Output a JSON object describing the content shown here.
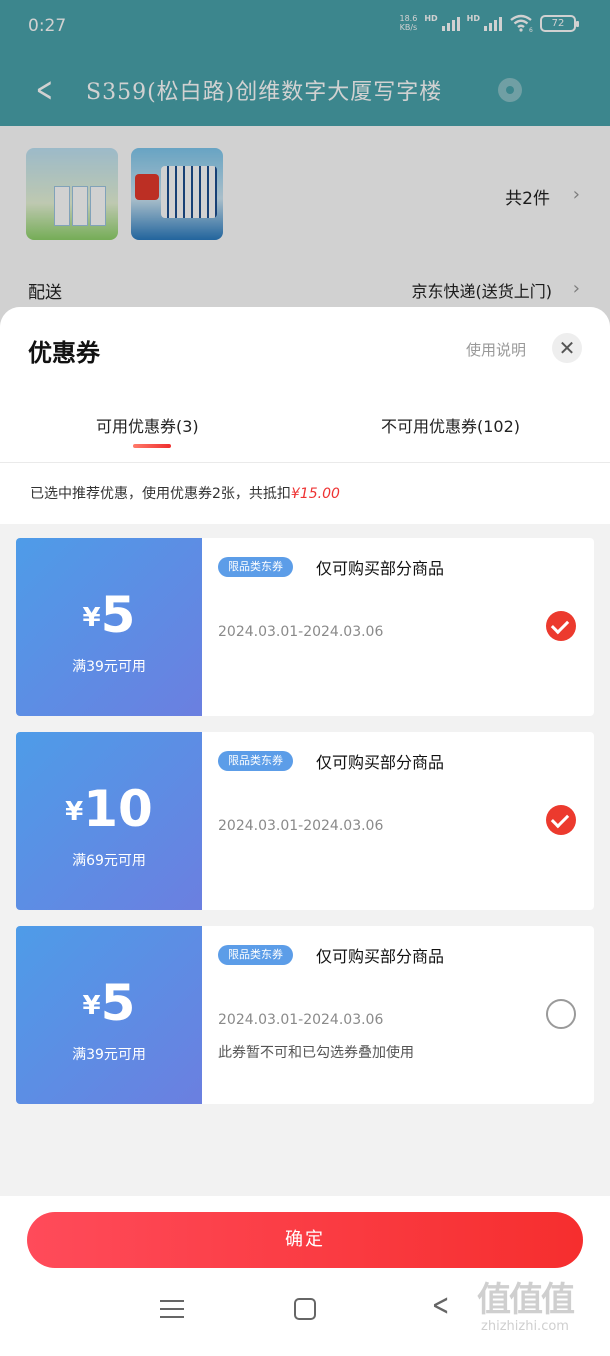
{
  "status_bar": {
    "time": "0:27",
    "net_speed": "18.6",
    "net_unit": "KB/s",
    "hd1": "HD",
    "hd2": "HD",
    "wifi_sub": "6",
    "battery": "72"
  },
  "nav": {
    "title": "S359(松白路)创维数字大厦写字楼",
    "back_icon": "chevron-left-icon",
    "location_icon": "location-pin-icon"
  },
  "order": {
    "item_count": "共2件",
    "delivery_label": "配送",
    "delivery_value": "京东快递(送货上门)"
  },
  "sheet": {
    "title": "优惠券",
    "usage_link": "使用说明",
    "close_icon": "close-icon",
    "tabs": [
      {
        "label": "可用优惠券(3)"
      },
      {
        "label": "不可用优惠券(102)"
      }
    ],
    "summary_prefix": "已选中推荐优惠，使用优惠券2张，共抵扣",
    "summary_amount": "¥15.00"
  },
  "coupons": [
    {
      "currency": "¥",
      "amount": "5",
      "threshold": "满39元可用",
      "badge": "限品类东券",
      "desc": "仅可购买部分商品",
      "validity": "2024.03.01-2024.03.06",
      "note": "",
      "selected": true
    },
    {
      "currency": "¥",
      "amount": "10",
      "threshold": "满69元可用",
      "badge": "限品类东券",
      "desc": "仅可购买部分商品",
      "validity": "2024.03.01-2024.03.06",
      "note": "",
      "selected": true
    },
    {
      "currency": "¥",
      "amount": "5",
      "threshold": "满39元可用",
      "badge": "限品类东券",
      "desc": "仅可购买部分商品",
      "validity": "2024.03.01-2024.03.06",
      "note": "此券暂不可和已勾选券叠加使用",
      "selected": false
    }
  ],
  "footer": {
    "confirm": "确定"
  },
  "watermark": {
    "logo": "值值值",
    "text": "zhizhizhi.com"
  },
  "colors": {
    "teal": "#4aa4ac",
    "accent_red": "#ec3a2e",
    "coupon_blue": "#5c9de8"
  }
}
